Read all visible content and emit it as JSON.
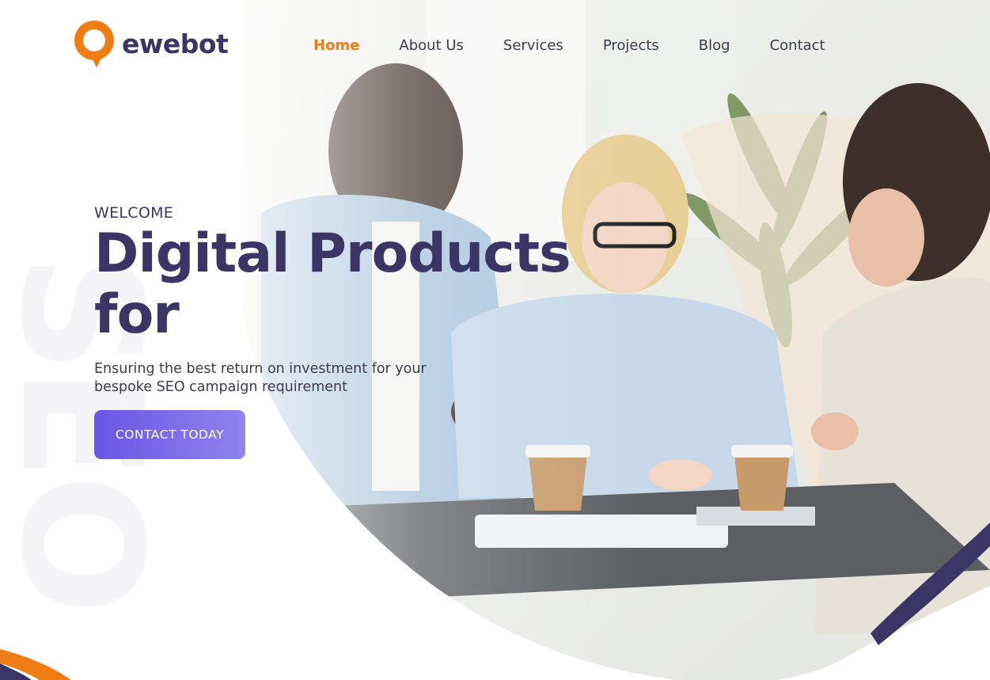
{
  "brand": {
    "name": "ewebot",
    "colors": {
      "primary": "#3a3564",
      "accent": "#f07d14",
      "button_from": "#6a55e6",
      "button_to": "#8f83ee"
    }
  },
  "nav": {
    "items": [
      {
        "label": "Home",
        "active": true
      },
      {
        "label": "About Us",
        "active": false
      },
      {
        "label": "Services",
        "active": false
      },
      {
        "label": "Projects",
        "active": false
      },
      {
        "label": "Blog",
        "active": false
      },
      {
        "label": "Contact",
        "active": false
      }
    ]
  },
  "hero": {
    "eyebrow": "WELCOME",
    "headline": "Digital Products for",
    "subtitle": "Ensuring the best return on investment for your bespoke SEO campaign requirement",
    "cta_label": "CONTACT TODAY",
    "watermark": "SEO",
    "image_icon": "team-meeting-photo"
  }
}
